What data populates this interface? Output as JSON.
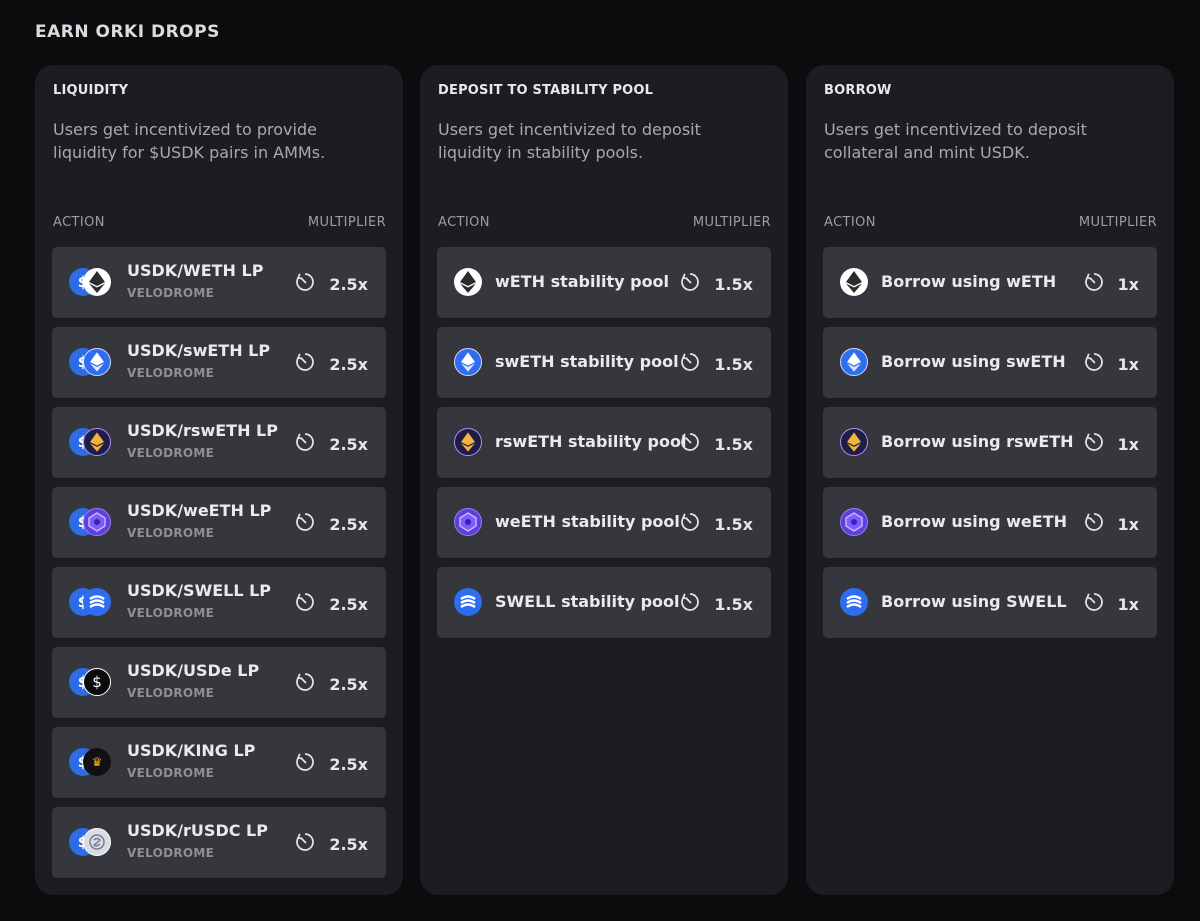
{
  "page": {
    "title": "EARN ORKI DROPS"
  },
  "columns_header": {
    "action": "ACTION",
    "multiplier": "MULTIPLIER"
  },
  "cards": [
    {
      "title": "LIQUIDITY",
      "description": "Users get incentivized to provide liquidity for $USDK pairs in AMMs.",
      "rows": [
        {
          "name": "USDK/WETH LP",
          "sub": "VELODROME",
          "multiplier": "2.5x",
          "icon": "weth-icon"
        },
        {
          "name": "USDK/swETH LP",
          "sub": "VELODROME",
          "multiplier": "2.5x",
          "icon": "sweth-icon"
        },
        {
          "name": "USDK/rswETH LP",
          "sub": "VELODROME",
          "multiplier": "2.5x",
          "icon": "rsweth-icon"
        },
        {
          "name": "USDK/weETH LP",
          "sub": "VELODROME",
          "multiplier": "2.5x",
          "icon": "weeth-icon"
        },
        {
          "name": "USDK/SWELL LP",
          "sub": "VELODROME",
          "multiplier": "2.5x",
          "icon": "swell-icon"
        },
        {
          "name": "USDK/USDe LP",
          "sub": "VELODROME",
          "multiplier": "2.5x",
          "icon": "usde-icon"
        },
        {
          "name": "USDK/KING LP",
          "sub": "VELODROME",
          "multiplier": "2.5x",
          "icon": "king-icon"
        },
        {
          "name": "USDK/rUSDC LP",
          "sub": "VELODROME",
          "multiplier": "2.5x",
          "icon": "rusdc-icon"
        }
      ]
    },
    {
      "title": "DEPOSIT TO STABILITY POOL",
      "description": "Users get incentivized to deposit liquidity in stability pools.",
      "rows": [
        {
          "name": "wETH stability pool",
          "multiplier": "1.5x",
          "icon": "weth-icon"
        },
        {
          "name": "swETH stability pool",
          "multiplier": "1.5x",
          "icon": "sweth-icon"
        },
        {
          "name": "rswETH stability pool",
          "multiplier": "1.5x",
          "icon": "rsweth-icon"
        },
        {
          "name": "weETH stability pool",
          "multiplier": "1.5x",
          "icon": "weeth-icon"
        },
        {
          "name": "SWELL stability pool",
          "multiplier": "1.5x",
          "icon": "swell-icon"
        }
      ]
    },
    {
      "title": "BORROW",
      "description": "Users get incentivized to deposit collateral and mint USDK.",
      "rows": [
        {
          "name": "Borrow using wETH",
          "multiplier": "1x",
          "icon": "weth-icon"
        },
        {
          "name": "Borrow using swETH",
          "multiplier": "1x",
          "icon": "sweth-icon"
        },
        {
          "name": "Borrow using rswETH",
          "multiplier": "1x",
          "icon": "rsweth-icon"
        },
        {
          "name": "Borrow using weETH",
          "multiplier": "1x",
          "icon": "weeth-icon"
        },
        {
          "name": "Borrow using SWELL",
          "multiplier": "1x",
          "icon": "swell-icon"
        }
      ]
    }
  ],
  "icons": {
    "usdk_symbol": "$",
    "usde_symbol": "$",
    "king_symbol": "♛"
  },
  "colors": {
    "background": "#0c0c0e",
    "card": "#1d1d21",
    "row": "#36363d",
    "usdk_blue": "#2e6be6"
  }
}
